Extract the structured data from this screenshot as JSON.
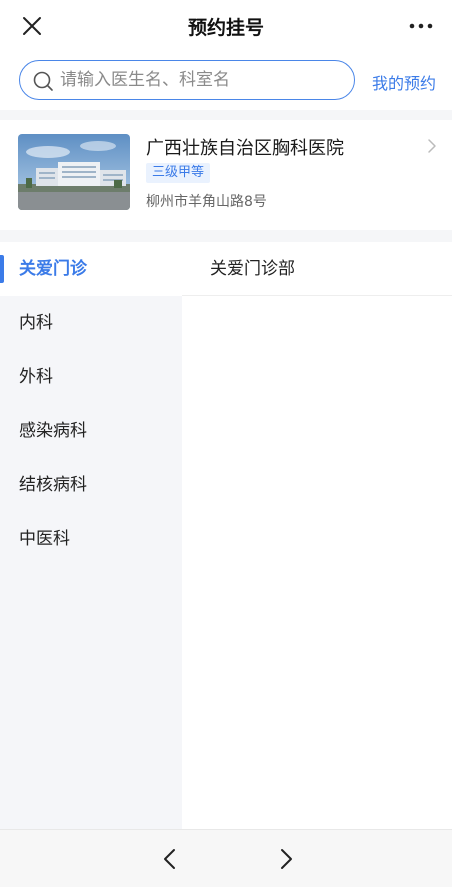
{
  "navbar": {
    "title": "预约挂号",
    "close_icon": "close-icon",
    "more_icon": "more-icon"
  },
  "search": {
    "placeholder": "请输入医生名、科室名",
    "value": "",
    "link_label": "我的预约"
  },
  "hospital": {
    "name": "广西壮族自治区胸科医院",
    "level": "三级甲等",
    "address": "柳州市羊角山路8号"
  },
  "departments": {
    "items": [
      {
        "label": "关爱门诊",
        "active": true
      },
      {
        "label": "内科",
        "active": false
      },
      {
        "label": "外科",
        "active": false
      },
      {
        "label": "感染病科",
        "active": false
      },
      {
        "label": "结核病科",
        "active": false
      },
      {
        "label": "中医科",
        "active": false
      }
    ],
    "sub_items": [
      {
        "label": "关爱门诊部"
      }
    ]
  },
  "colors": {
    "accent": "#3b7be8",
    "sidebar_bg": "#f5f6f9"
  }
}
